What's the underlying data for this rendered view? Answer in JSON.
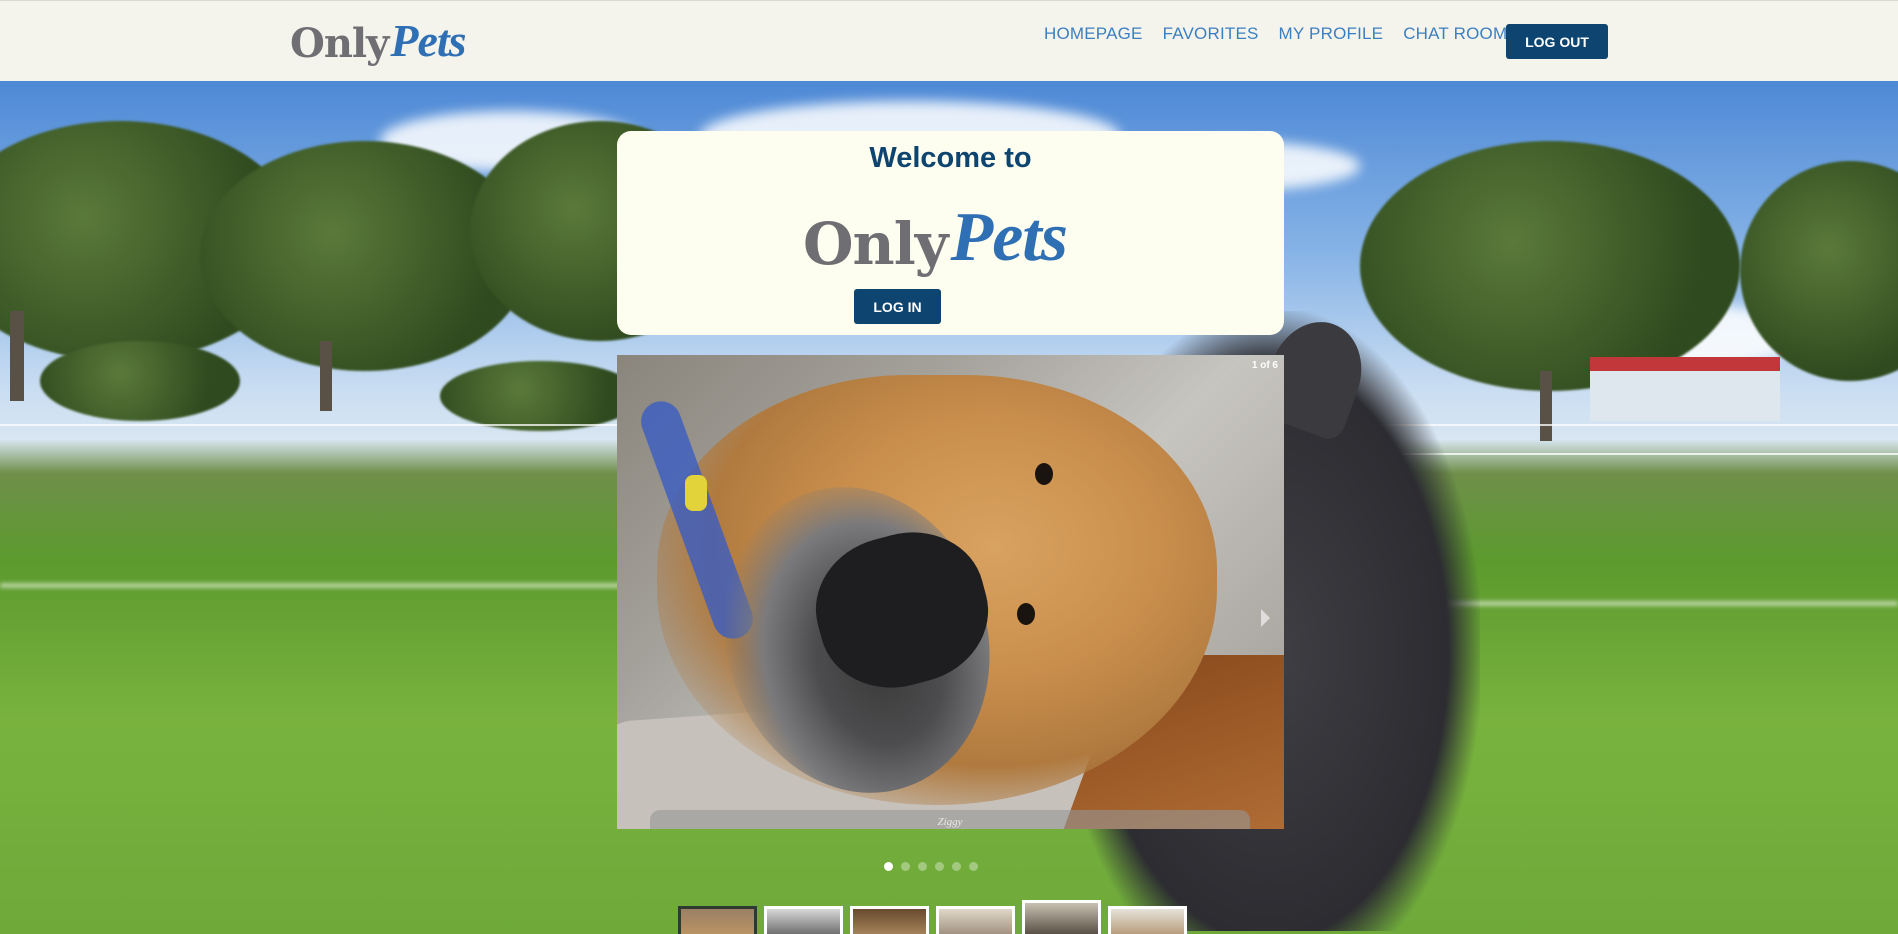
{
  "header": {
    "logo": {
      "text_a": "Only",
      "text_b": "Pets"
    },
    "nav": [
      "HOMEPAGE",
      "FAVORITES",
      "MY PROFILE",
      "CHAT ROOM"
    ],
    "logout_label": "LOG OUT"
  },
  "welcome": {
    "title": "Welcome to",
    "logo": {
      "text_a": "Only",
      "text_b": "Pets"
    },
    "login_label": "LOG IN"
  },
  "slideshow": {
    "counter": "1 of 6",
    "caption": "Ziggy",
    "slide_count": 6,
    "active_index": 0,
    "thumbnail_count": 6,
    "selected_thumbnails": [
      0,
      4
    ]
  },
  "colors": {
    "brand_navy": "#0e4470",
    "nav_link": "#3c7fc1",
    "logo_grey": "#6f6f73",
    "logo_blue": "#2f6fb4",
    "header_bg": "#f4f4ec",
    "card_bg": "#fdfdf0"
  }
}
